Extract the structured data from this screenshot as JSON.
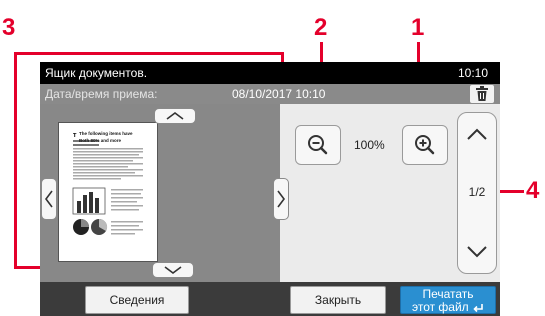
{
  "screen": {
    "title": "Ящик документов.",
    "clock": "10:10",
    "info": {
      "label": "Дата/время приема:",
      "value": "08/10/2017 10:10"
    }
  },
  "document_preview": {
    "heading": "The following items have",
    "heading2": "Both 80% and more"
  },
  "zoom": {
    "level": "100%"
  },
  "pager": {
    "current": "1/2"
  },
  "buttons": {
    "details": "Сведения",
    "close": "Закрыть",
    "print_line1": "Печатать",
    "print_line2": "этот файл"
  },
  "callouts": {
    "one": "1",
    "two": "2",
    "three": "3",
    "four": "4"
  },
  "colors": {
    "callout": "#e4002b",
    "print_button": "#2a8fd1",
    "titlebar": "#000000"
  },
  "icons": [
    "zoom-out-icon",
    "zoom-in-icon",
    "trash-icon",
    "chevron-up-icon",
    "chevron-down-icon",
    "chevron-left-icon",
    "chevron-right-icon",
    "enter-arrow-icon"
  ]
}
